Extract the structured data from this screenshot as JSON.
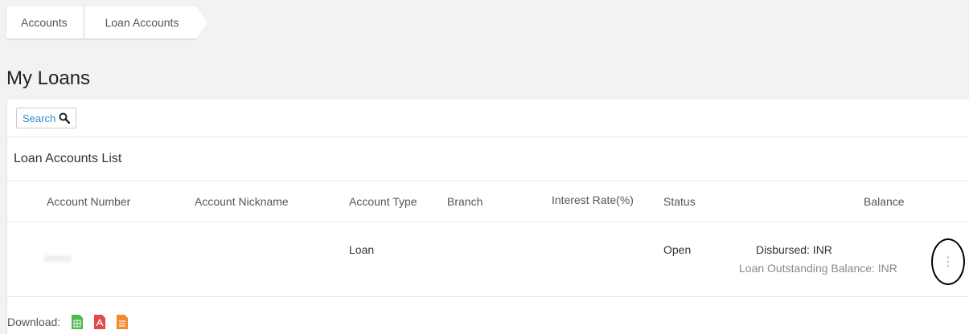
{
  "breadcrumb": {
    "items": [
      "Accounts",
      "Loan Accounts"
    ]
  },
  "page": {
    "title": "My Loans"
  },
  "search": {
    "label": "Search"
  },
  "list": {
    "title": "Loan Accounts List"
  },
  "table": {
    "headers": [
      "Account Number",
      "Account Nickname",
      "Account Type",
      "Branch",
      "Interest Rate(%)",
      "Status",
      "Balance"
    ],
    "row": {
      "account_type": "Loan",
      "status": "Open",
      "disbursed_label": "Disbursed: INR",
      "outstanding_label": "Loan Outstanding Balance: INR"
    }
  },
  "download": {
    "label": "Download:",
    "icons": [
      "excel-icon",
      "pdf-icon",
      "csv-icon"
    ]
  },
  "colors": {
    "excel": "#4cbb4c",
    "pdf": "#e24b4b",
    "csv": "#f08a2c",
    "link": "#2a8fd0"
  }
}
